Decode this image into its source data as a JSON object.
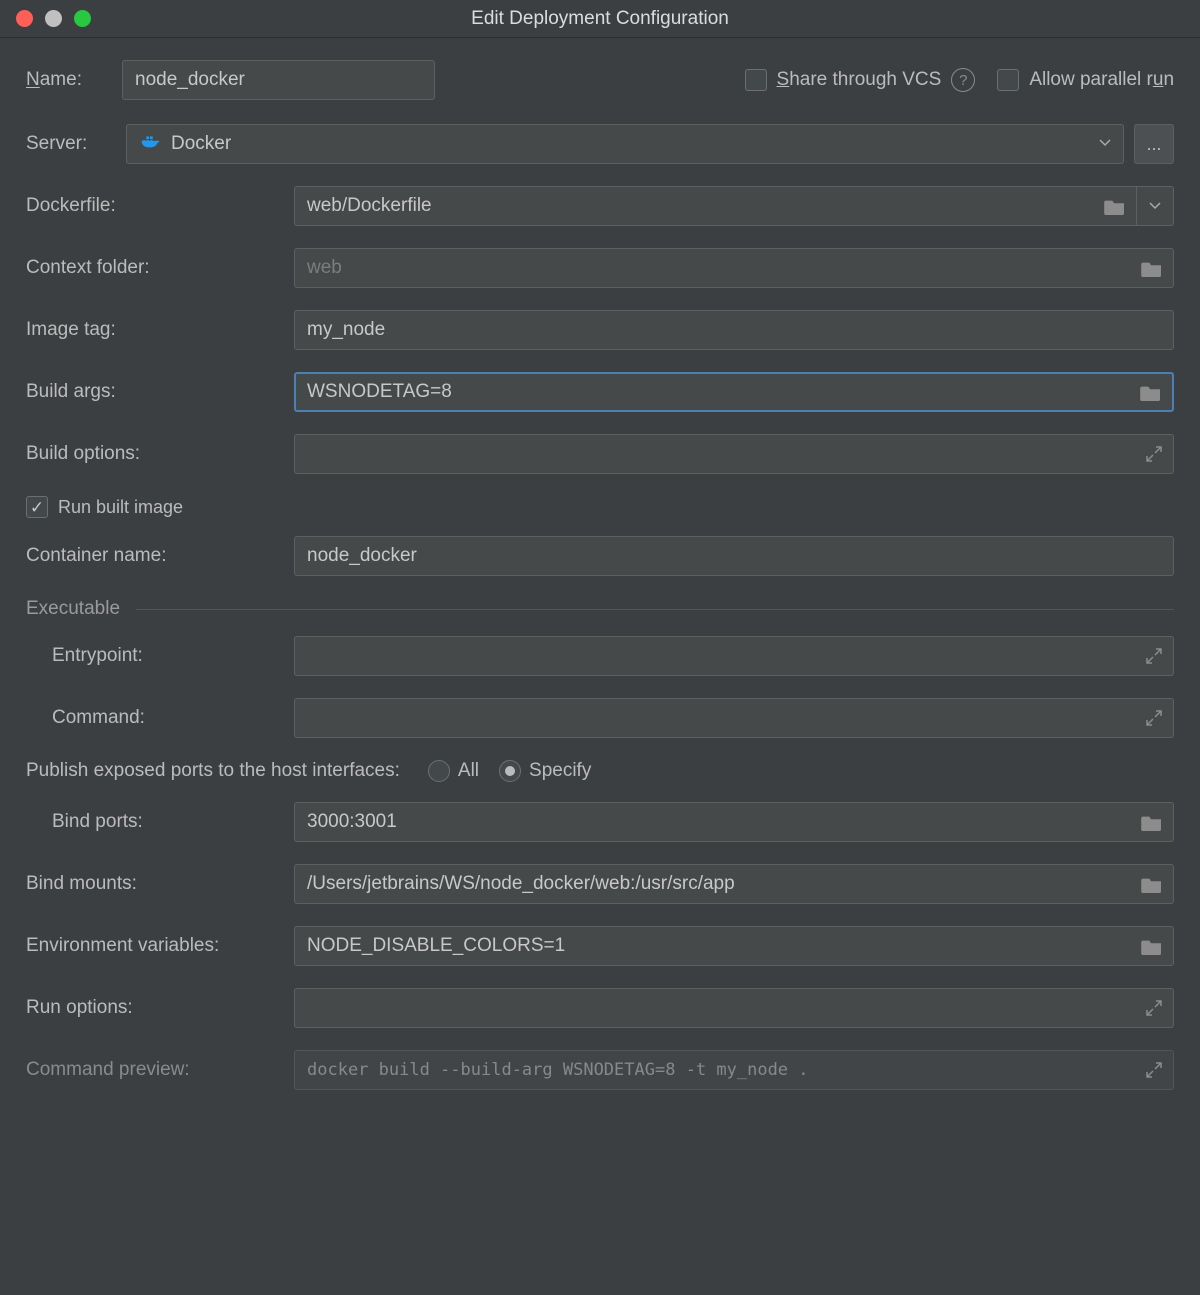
{
  "window": {
    "title": "Edit Deployment Configuration"
  },
  "header": {
    "name_label": "Name:",
    "name_value": "node_docker",
    "share_label": "Share through VCS",
    "share_checked": false,
    "parallel_label": "Allow parallel run",
    "parallel_checked": false
  },
  "server": {
    "label": "Server:",
    "value": "Docker",
    "icon": "docker-icon",
    "ellipsis": "..."
  },
  "fields": {
    "dockerfile": {
      "label": "Dockerfile:",
      "value": "web/Dockerfile"
    },
    "context_folder": {
      "label": "Context folder:",
      "placeholder": "web",
      "value": ""
    },
    "image_tag": {
      "label": "Image tag:",
      "value": "my_node"
    },
    "build_args": {
      "label": "Build args:",
      "value": "WSNODETAG=8"
    },
    "build_options": {
      "label": "Build options:",
      "value": ""
    },
    "run_built_image": {
      "label": "Run built image",
      "checked": true
    },
    "container_name": {
      "label": "Container name:",
      "value": "node_docker"
    }
  },
  "executable": {
    "legend": "Executable",
    "entrypoint": {
      "label": "Entrypoint:",
      "value": ""
    },
    "command": {
      "label": "Command:",
      "value": ""
    }
  },
  "ports": {
    "publish_label": "Publish exposed ports to the host interfaces:",
    "all_label": "All",
    "specify_label": "Specify",
    "selected": "Specify",
    "bind_ports": {
      "label": "Bind ports:",
      "value": "3000:3001"
    }
  },
  "mounts": {
    "bind_mounts": {
      "label": "Bind mounts:",
      "value": "/Users/jetbrains/WS/node_docker/web:/usr/src/app"
    }
  },
  "env": {
    "label": "Environment variables:",
    "value": "NODE_DISABLE_COLORS=1"
  },
  "run_options": {
    "label": "Run options:",
    "value": ""
  },
  "command_preview": {
    "label": "Command preview:",
    "value": "docker build --build-arg WSNODETAG=8 -t my_node ."
  }
}
